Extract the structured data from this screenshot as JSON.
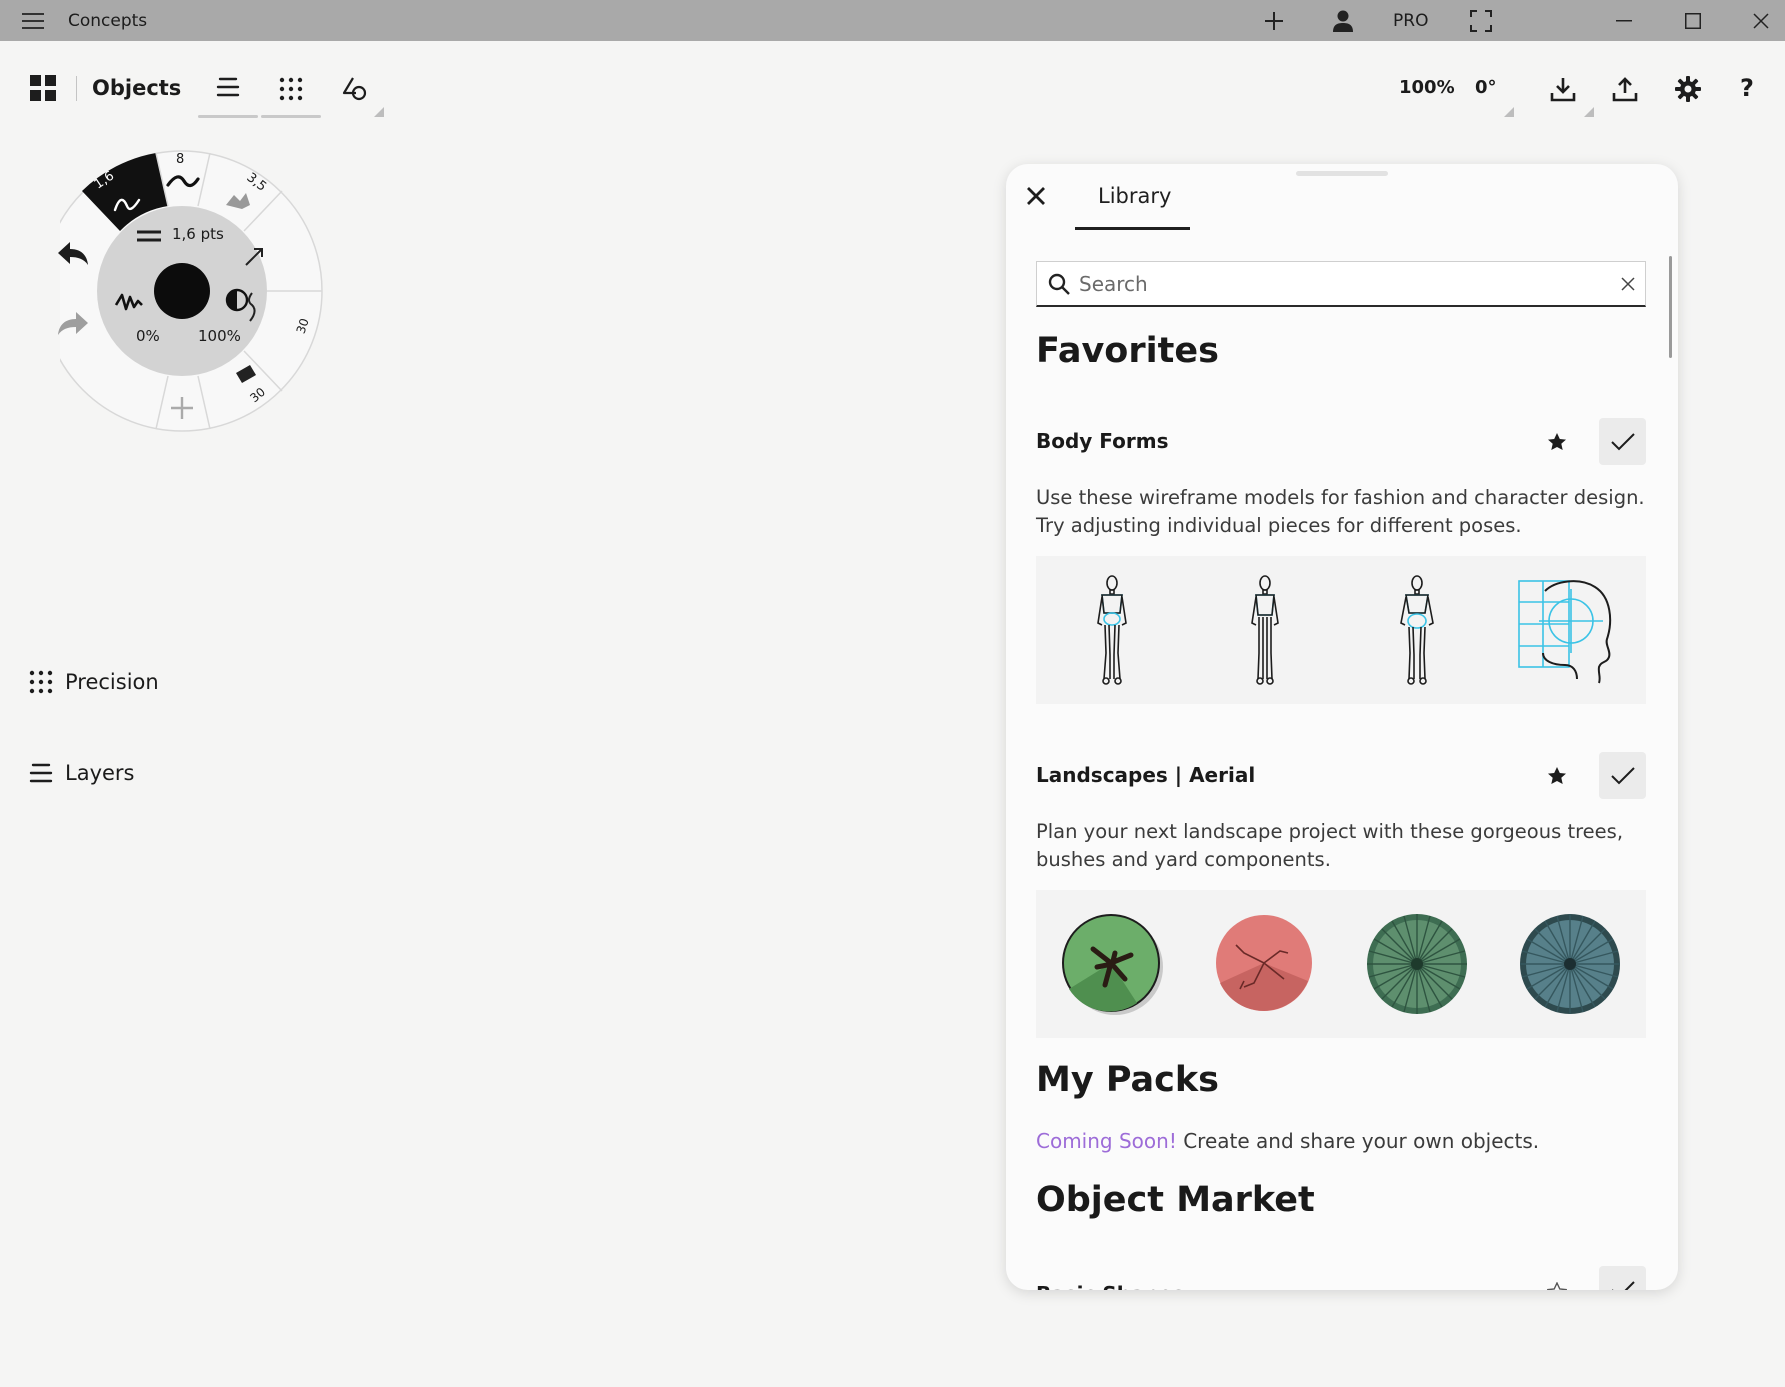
{
  "titlebar": {
    "app_title": "Concepts",
    "pro_label": "PRO"
  },
  "toolbar": {
    "section_label": "Objects",
    "zoom": "100%",
    "rotation": "0°"
  },
  "brush_wheel": {
    "size_label": "1,6 pts",
    "opacity_label": "0%",
    "smoothing_label": "100%",
    "slots": [
      "1,6",
      "8",
      "3,5",
      "30",
      "30"
    ]
  },
  "side": {
    "precision_label": "Precision",
    "layers_label": "Layers"
  },
  "library": {
    "tab_label": "Library",
    "search_placeholder": "Search",
    "favorites_heading": "Favorites",
    "packs": [
      {
        "title": "Body Forms",
        "description": "Use these wireframe models for fashion and character design. Try adjusting individual pieces for different poses."
      },
      {
        "title": "Landscapes | Aerial",
        "description": "Plan your next landscape project with these gorgeous trees, bushes and yard components."
      }
    ],
    "my_packs_heading": "My Packs",
    "coming_soon": "Coming Soon!",
    "coming_soon_rest": " Create and share your own objects.",
    "market_heading": "Object Market",
    "market_first_item": "Basic Shapes"
  },
  "colors": {
    "titlebar_bg": "#a9a9a9",
    "canvas_bg": "#f5f5f4",
    "accent_purple": "#9d6cd8",
    "wireframe_cyan": "#3bc3e6"
  }
}
